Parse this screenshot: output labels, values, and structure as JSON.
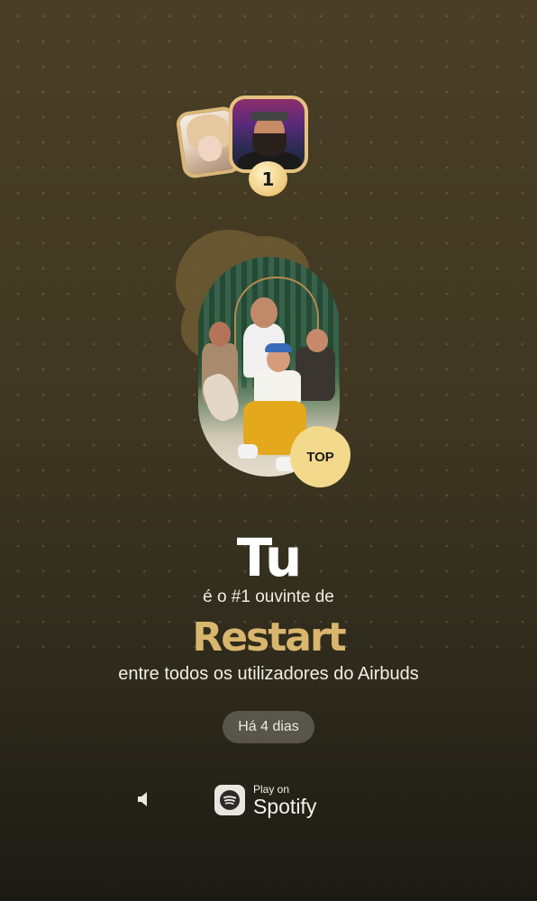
{
  "header": {
    "rank_number": "1"
  },
  "cover": {
    "badge_label": "TOP"
  },
  "main": {
    "name": "Tu",
    "line1": "é o #1 ouvinte de",
    "artist": "Restart",
    "line2": "entre todos os utilizadores do Airbuds",
    "time_ago": "Há 4 dias"
  },
  "footer": {
    "play_on_label": "Play on",
    "service_label": "Spotify"
  },
  "icons": {
    "volume": "speaker-icon",
    "spotify": "spotify-logo-icon"
  },
  "colors": {
    "accent_gold": "#d9b66d",
    "badge": "#f3d98b",
    "background_top": "#4a3f26",
    "background_bottom": "#1c1a14"
  }
}
